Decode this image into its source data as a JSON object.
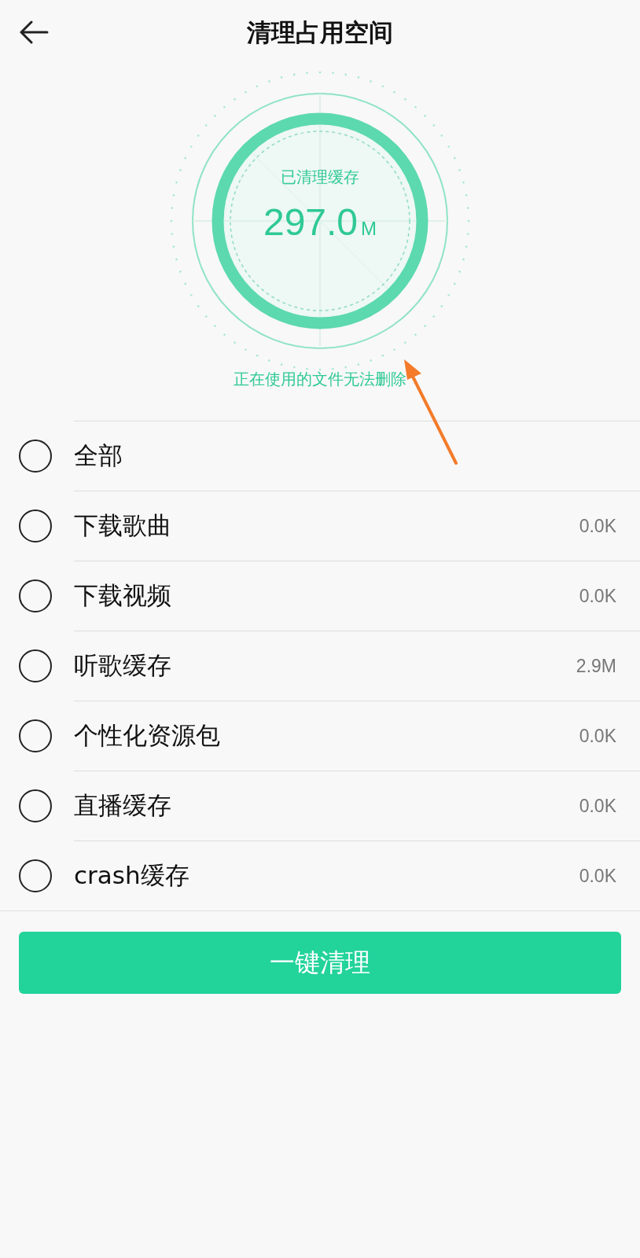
{
  "header": {
    "title": "清理占用空间"
  },
  "gauge": {
    "label": "已清理缓存",
    "value": "297.0",
    "unit": "M",
    "note": "正在使用的文件无法删除"
  },
  "items": [
    {
      "label": "全部",
      "selected": false
    },
    {
      "label": "下载歌曲",
      "size": "0.0K",
      "selected": false
    },
    {
      "label": "下载视频",
      "size": "0.0K",
      "selected": false
    },
    {
      "label": "听歌缓存",
      "size": "2.9M",
      "selected": false
    },
    {
      "label": "个性化资源包",
      "size": "0.0K",
      "selected": false
    },
    {
      "label": "直播缓存",
      "size": "0.0K",
      "selected": false
    },
    {
      "label": "crash缓存",
      "size": "0.0K",
      "selected": false
    }
  ],
  "button": {
    "label": "一键清理"
  }
}
